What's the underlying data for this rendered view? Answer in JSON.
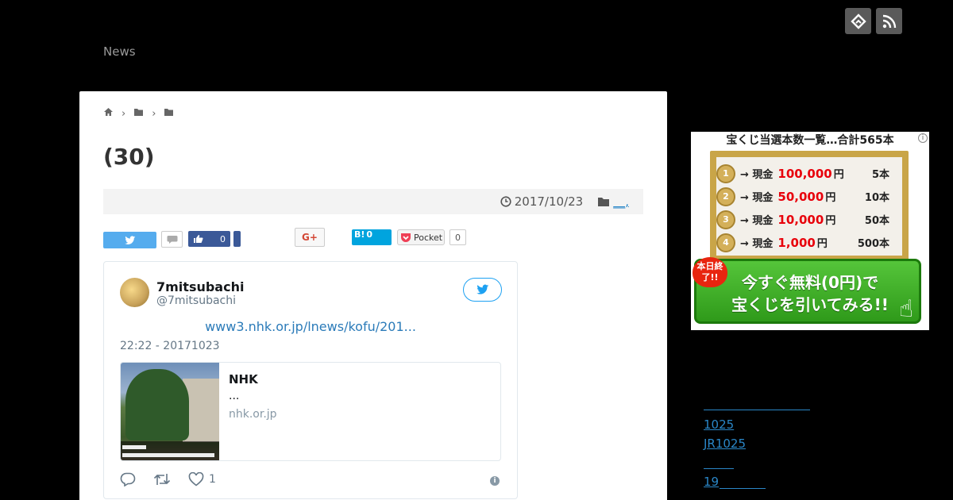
{
  "header": {
    "site_title": "News",
    "icons": [
      "feedly-icon",
      "rss-icon"
    ]
  },
  "breadcrumb": {
    "icons": [
      "home-icon",
      "folder-icon",
      "folder-icon"
    ]
  },
  "article": {
    "title": "(30)",
    "date": "2017/10/23",
    "category": "__,"
  },
  "share": {
    "facebook_count": "0",
    "hatena_label": "B!",
    "hatena_count": "0",
    "pocket_label": "Pocket",
    "pocket_count": "0",
    "gplus_label": "G+"
  },
  "tweet": {
    "name": "7mitsubachi",
    "handle": "@7mitsubachi",
    "link": "www3.nhk.or.jp/lnews/kofu/201...",
    "time": "22:22 - 20171023",
    "card_title": "NHK",
    "card_desc": "...",
    "card_domain": "nhk.or.jp",
    "like_count": "1"
  },
  "ad": {
    "headline": "宝くじ当選本数一覧…合計565本",
    "rows": [
      {
        "rank": "1",
        "prefix": "→ 現金",
        "amount": "100,000",
        "suffix": "円",
        "count": "5本"
      },
      {
        "rank": "2",
        "prefix": "→ 現金",
        "amount": "50,000",
        "suffix": "円",
        "count": "10本"
      },
      {
        "rank": "3",
        "prefix": "→ 現金",
        "amount": "10,000",
        "suffix": "円",
        "count": "50本"
      },
      {
        "rank": "4",
        "prefix": "→ 現金",
        "amount": "1,000",
        "suffix": "円",
        "count": "500本"
      }
    ],
    "badge": "本日終了!!",
    "cta_line1": "今すぐ無料(0円)で",
    "cta_line2": "宝くじを引いてみる!!",
    "colors": {
      "gold": "#c9a548",
      "red": "#e8000b",
      "green": "#2f9a1a"
    }
  },
  "sidebar": {
    "links": [
      "1025",
      "JR1025",
      "19"
    ]
  }
}
